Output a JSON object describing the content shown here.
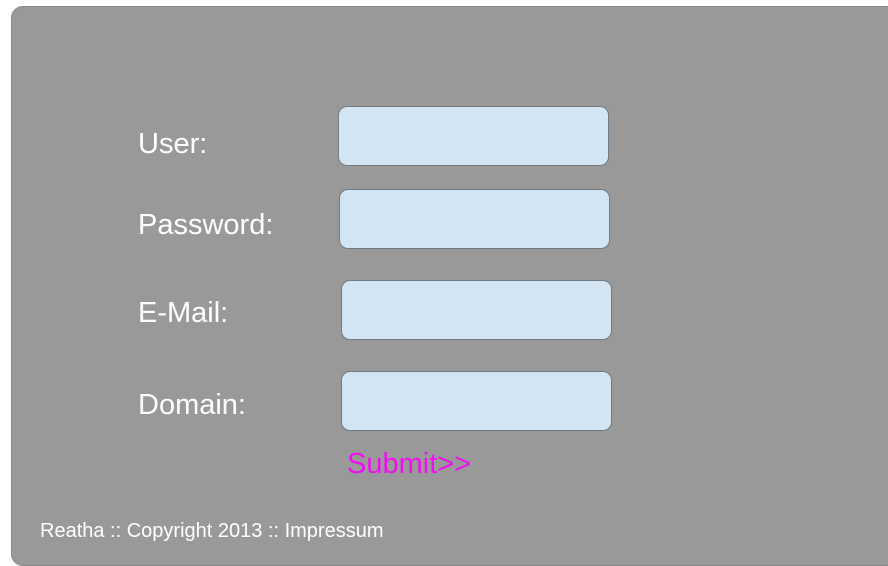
{
  "form": {
    "user_label": "User:",
    "password_label": "Password:",
    "email_label": "E-Mail:",
    "domain_label": "Domain:",
    "user_value": "",
    "password_value": "",
    "email_value": "",
    "domain_value": "",
    "submit_label": "Submit>>"
  },
  "footer": {
    "text": "Reatha :: Copyright 2013 :: Impressum"
  },
  "colors": {
    "panel_background": "#999999",
    "field_background": "#d3e5f2",
    "submit_link": "#ee11ee",
    "label_text": "#ffffff"
  }
}
